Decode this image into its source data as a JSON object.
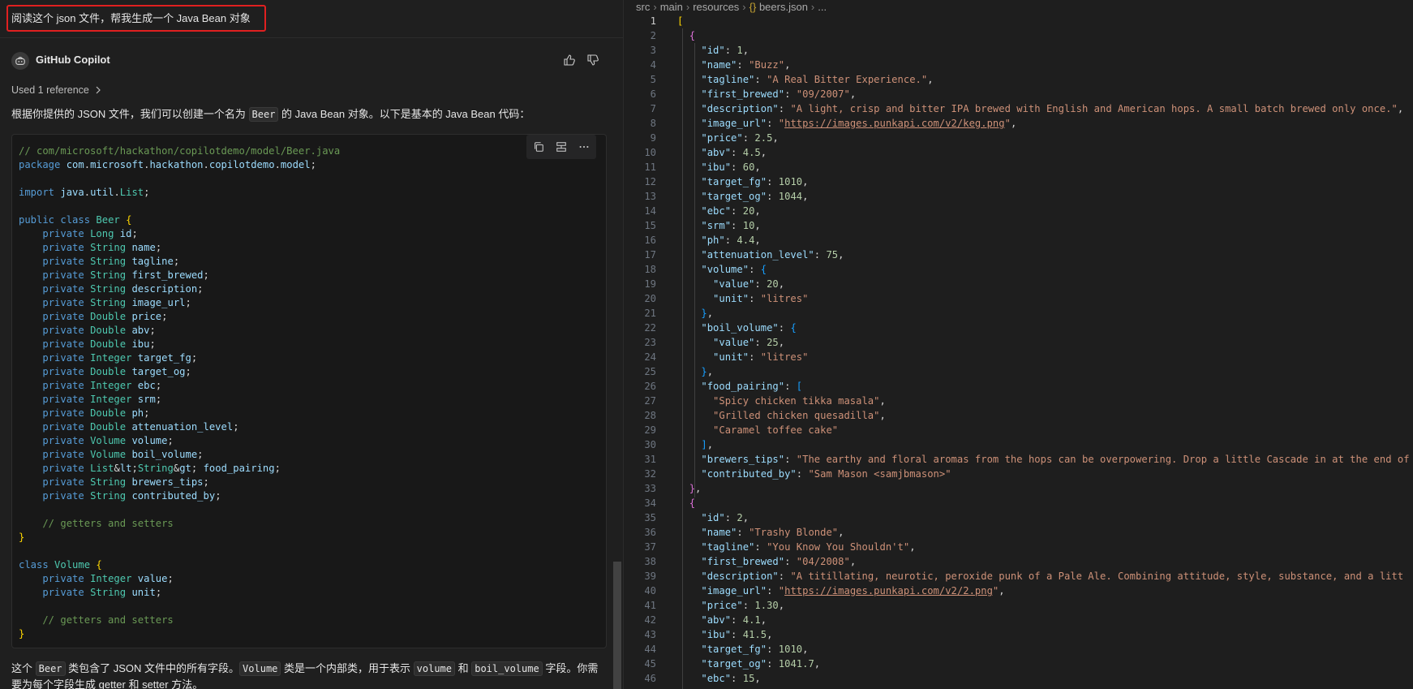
{
  "chat": {
    "user_message": "阅读这个 json 文件，帮我生成一个 Java Bean 对象",
    "assistant_name": "GitHub Copilot",
    "used_reference": "Used 1 reference",
    "intro_before": "根据你提供的 JSON 文件，我们可以创建一个名为 ",
    "intro_code": "Beer",
    "intro_after": " 的 Java Bean 对象。以下是基本的 Java Bean 代码：",
    "code_lines": [
      "// com/microsoft/hackathon/copilotdemo/model/Beer.java",
      "package com.microsoft.hackathon.copilotdemo.model;",
      "",
      "import java.util.List;",
      "",
      "public class Beer {",
      "    private Long id;",
      "    private String name;",
      "    private String tagline;",
      "    private String first_brewed;",
      "    private String description;",
      "    private String image_url;",
      "    private Double price;",
      "    private Double abv;",
      "    private Double ibu;",
      "    private Integer target_fg;",
      "    private Double target_og;",
      "    private Integer ebc;",
      "    private Integer srm;",
      "    private Double ph;",
      "    private Double attenuation_level;",
      "    private Volume volume;",
      "    private Volume boil_volume;",
      "    private List<String> food_pairing;",
      "    private String brewers_tips;",
      "    private String contributed_by;",
      "",
      "    // getters and setters",
      "}",
      "",
      "class Volume {",
      "    private Integer value;",
      "    private String unit;",
      "",
      "    // getters and setters",
      "}"
    ],
    "outro": [
      {
        "t": "这个 "
      },
      {
        "c": "Beer"
      },
      {
        "t": " 类包含了 JSON 文件中的所有字段。"
      },
      {
        "c": "Volume"
      },
      {
        "t": " 类是一个内部类，用于表示 "
      },
      {
        "c": "volume"
      },
      {
        "t": " 和 "
      },
      {
        "c": "boil_volume"
      },
      {
        "t": " 字段。你需要为每个字段生成 getter 和 setter 方法。"
      }
    ]
  },
  "editor": {
    "breadcrumb": [
      "src",
      "main",
      "resources",
      "{} beers.json",
      "..."
    ],
    "lines": [
      "[",
      "  {",
      "    \"id\": 1,",
      "    \"name\": \"Buzz\",",
      "    \"tagline\": \"A Real Bitter Experience.\",",
      "    \"first_brewed\": \"09/2007\",",
      "    \"description\": \"A light, crisp and bitter IPA brewed with English and American hops. A small batch brewed only once.\",",
      "    \"image_url\": \"https://images.punkapi.com/v2/keg.png\",",
      "    \"price\": 2.5,",
      "    \"abv\": 4.5,",
      "    \"ibu\": 60,",
      "    \"target_fg\": 1010,",
      "    \"target_og\": 1044,",
      "    \"ebc\": 20,",
      "    \"srm\": 10,",
      "    \"ph\": 4.4,",
      "    \"attenuation_level\": 75,",
      "    \"volume\": {",
      "      \"value\": 20,",
      "      \"unit\": \"litres\"",
      "    },",
      "    \"boil_volume\": {",
      "      \"value\": 25,",
      "      \"unit\": \"litres\"",
      "    },",
      "    \"food_pairing\": [",
      "      \"Spicy chicken tikka masala\",",
      "      \"Grilled chicken quesadilla\",",
      "      \"Caramel toffee cake\"",
      "    ],",
      "    \"brewers_tips\": \"The earthy and floral aromas from the hops can be overpowering. Drop a little Cascade in at the end of",
      "    \"contributed_by\": \"Sam Mason <samjbmason>\"",
      "  },",
      "  {",
      "    \"id\": 2,",
      "    \"name\": \"Trashy Blonde\",",
      "    \"tagline\": \"You Know You Shouldn't\",",
      "    \"first_brewed\": \"04/2008\",",
      "    \"description\": \"A titillating, neurotic, peroxide punk of a Pale Ale. Combining attitude, style, substance, and a litt",
      "    \"image_url\": \"https://images.punkapi.com/v2/2.png\",",
      "    \"price\": 1.30,",
      "    \"abv\": 4.1,",
      "    \"ibu\": 41.5,",
      "    \"target_fg\": 1010,",
      "    \"target_og\": 1041.7,",
      "    \"ebc\": 15,"
    ]
  }
}
